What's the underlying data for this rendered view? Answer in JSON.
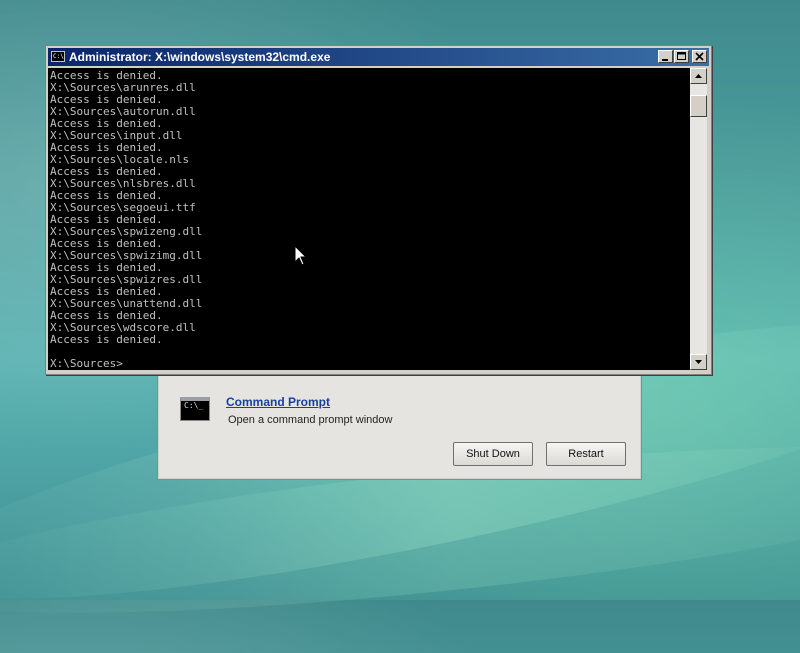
{
  "cmd_window": {
    "title": "Administrator: X:\\windows\\system32\\cmd.exe",
    "icon_text": "C:\\",
    "console_lines": [
      "Access is denied.",
      "X:\\Sources\\arunres.dll",
      "Access is denied.",
      "X:\\Sources\\autorun.dll",
      "Access is denied.",
      "X:\\Sources\\input.dll",
      "Access is denied.",
      "X:\\Sources\\locale.nls",
      "Access is denied.",
      "X:\\Sources\\nlsbres.dll",
      "Access is denied.",
      "X:\\Sources\\segoeui.ttf",
      "Access is denied.",
      "X:\\Sources\\spwizeng.dll",
      "Access is denied.",
      "X:\\Sources\\spwizimg.dll",
      "Access is denied.",
      "X:\\Sources\\spwizres.dll",
      "Access is denied.",
      "X:\\Sources\\unattend.dll",
      "Access is denied.",
      "X:\\Sources\\wdscore.dll",
      "Access is denied.",
      "",
      "X:\\Sources>"
    ]
  },
  "recovery_dialog": {
    "option_icon_text": "C:\\_",
    "option_title": "Command Prompt",
    "option_description": "Open a command prompt window",
    "shutdown_label": "Shut Down",
    "restart_label": "Restart"
  },
  "colors": {
    "console_bg": "#000000",
    "console_text": "#c0c0c0",
    "titlebar_start": "#0a246a",
    "titlebar_end": "#3a6ea5",
    "link": "#1b3fa0"
  }
}
